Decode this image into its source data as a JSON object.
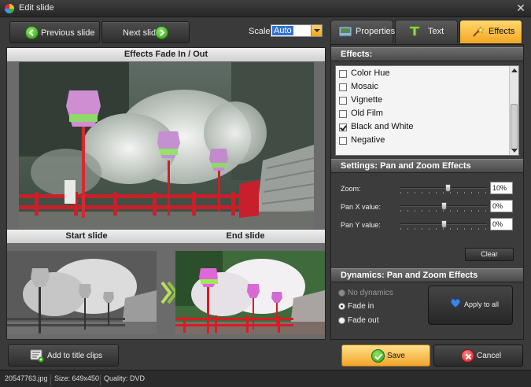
{
  "window": {
    "title": "Edit slide"
  },
  "toolbar": {
    "prev_label": "Previous slide",
    "next_label": "Next slide",
    "scale_label": "Scale:",
    "scale_value": "Auto"
  },
  "preview": {
    "header": "Effects Fade In / Out",
    "start_label": "Start slide",
    "end_label": "End slide"
  },
  "tabs": [
    {
      "label": "Properties",
      "icon": "properties-icon",
      "active": false
    },
    {
      "label": "Text",
      "icon": "text-icon",
      "active": false
    },
    {
      "label": "Effects",
      "icon": "effects-icon",
      "active": true
    }
  ],
  "effects": {
    "header": "Effects:",
    "items": [
      {
        "label": "Color Hue",
        "checked": false
      },
      {
        "label": "Mosaic",
        "checked": false
      },
      {
        "label": "Vignette",
        "checked": false
      },
      {
        "label": "Old Film",
        "checked": false
      },
      {
        "label": "Black and White",
        "checked": true
      },
      {
        "label": "Negative",
        "checked": false
      }
    ]
  },
  "settings": {
    "header": "Settings: Pan and Zoom Effects",
    "zoom_label": "Zoom:",
    "zoom_value": "10%",
    "zoom_level": 0.55,
    "panx_label": "Pan X value:",
    "panx_value": "0%",
    "panx_level": 0.5,
    "pany_label": "Pan Y value:",
    "pany_value": "0%",
    "pany_level": 0.5,
    "clear_label": "Clear"
  },
  "dynamics": {
    "header": "Dynamics: Pan and Zoom Effects",
    "options": [
      {
        "label": "No dynamics",
        "selected": false,
        "disabled": true
      },
      {
        "label": "Fade in",
        "selected": true,
        "disabled": false
      },
      {
        "label": "Fade out",
        "selected": false,
        "disabled": false
      }
    ],
    "apply_label": "Apply to all"
  },
  "actions": {
    "add_title_label": "Add to title clips",
    "save_label": "Save",
    "cancel_label": "Cancel"
  },
  "status": {
    "file": "20547763.jpg",
    "size": "Size: 649x450",
    "quality": "Quality: DVD"
  },
  "colors": {
    "accent": "#f4a623",
    "save_green": "#2c9a14",
    "cancel_red": "#d42a2a",
    "bridge_red": "#c8202a"
  }
}
